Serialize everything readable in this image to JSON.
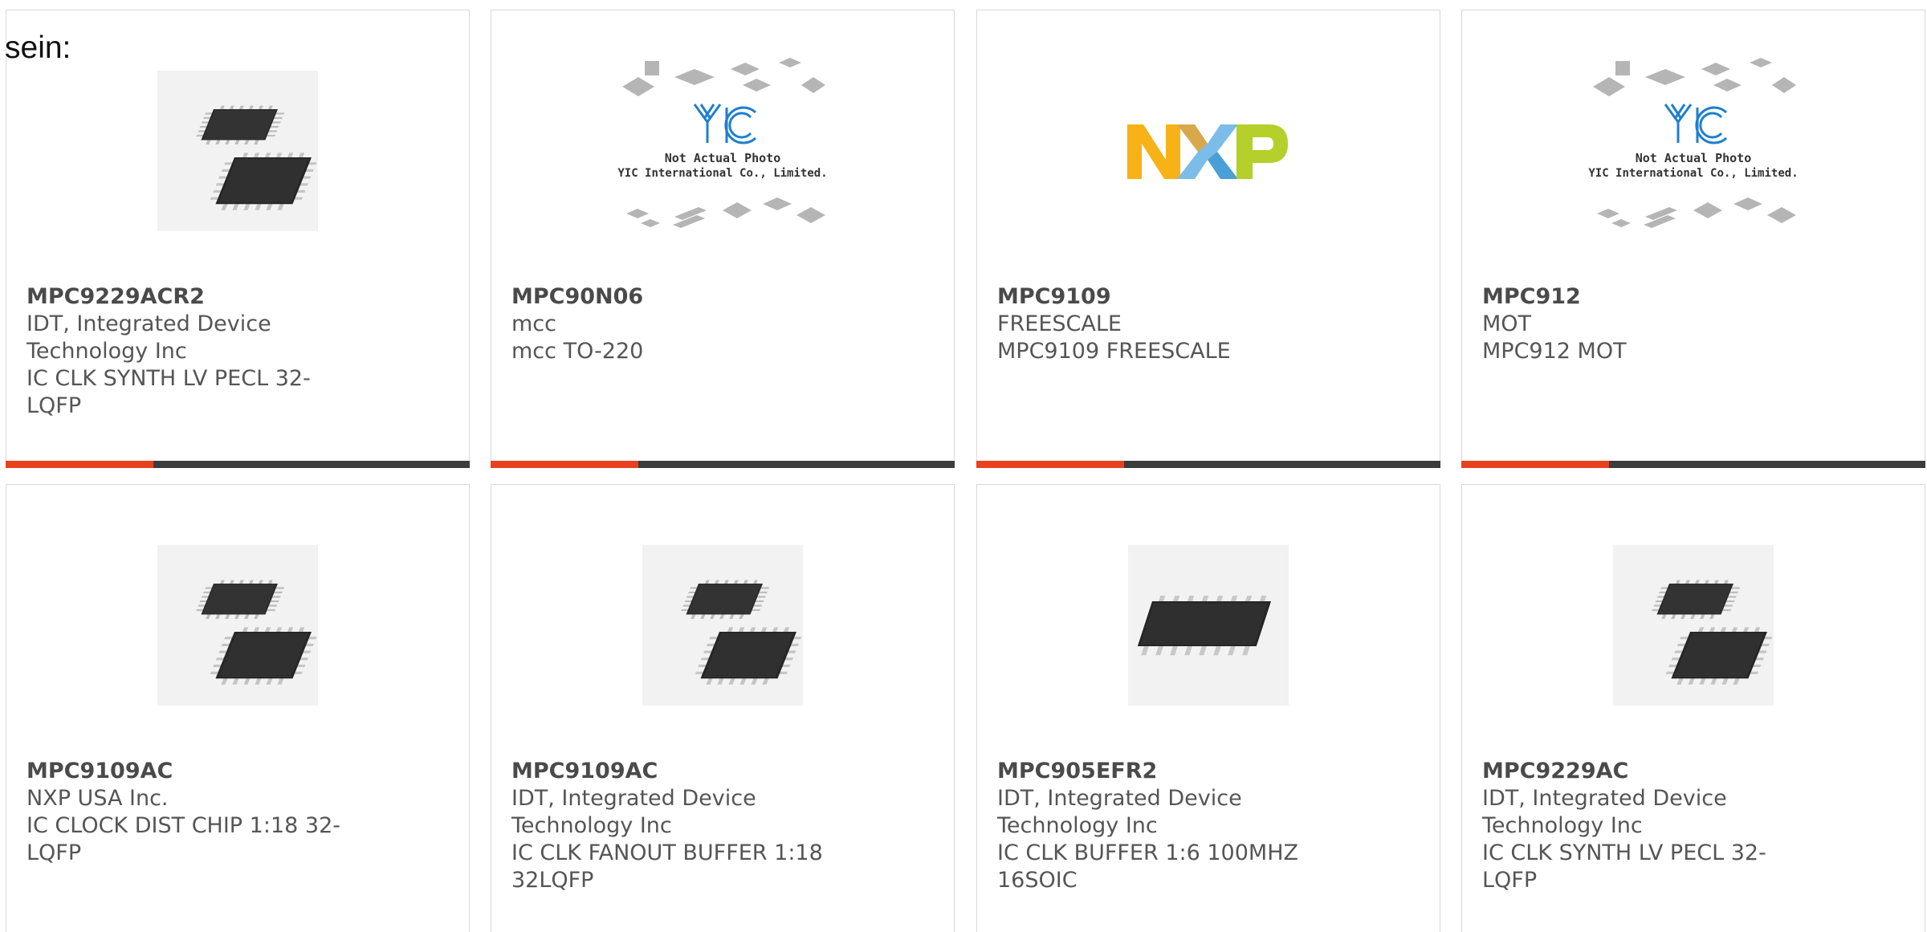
{
  "prefix_text": "sein:",
  "colors": {
    "accent": "#e8411d",
    "bar": "#3c3c3c",
    "border": "#d9d9d9",
    "text": "#555555"
  },
  "products": [
    {
      "part_number": "MPC9229ACR2",
      "manufacturer": "IDT, Integrated Device Technology Inc",
      "description": "IC CLK SYNTH LV PECL 32-LQFP",
      "image": "lqfp-chip-photo"
    },
    {
      "part_number": "MPC90N06",
      "manufacturer": "mcc",
      "description": "mcc TO-220",
      "image": "yic-placeholder",
      "image_caption_1": "Not Actual Photo",
      "image_caption_2": "YIC International Co., Limited."
    },
    {
      "part_number": "MPC9109",
      "manufacturer": "FREESCALE",
      "description": "MPC9109 FREESCALE",
      "image": "nxp-logo",
      "logo_text": "NXP"
    },
    {
      "part_number": "MPC912",
      "manufacturer": "MOT",
      "description": "MPC912 MOT",
      "image": "yic-placeholder",
      "image_caption_1": "Not Actual Photo",
      "image_caption_2": "YIC International Co., Limited."
    },
    {
      "part_number": "MPC9109AC",
      "manufacturer": "NXP USA Inc.",
      "description": "IC CLOCK DIST CHIP 1:18 32-LQFP",
      "image": "lqfp-chip-photo"
    },
    {
      "part_number": "MPC9109AC",
      "manufacturer": "IDT, Integrated Device Technology Inc",
      "description": "IC CLK FANOUT BUFFER 1:18 32LQFP",
      "image": "lqfp-chip-photo"
    },
    {
      "part_number": "MPC905EFR2",
      "manufacturer": "IDT, Integrated Device Technology Inc",
      "description": "IC CLK BUFFER 1:6 100MHZ 16SOIC",
      "image": "soic-chip-photo"
    },
    {
      "part_number": "MPC9229AC",
      "manufacturer": "IDT, Integrated Device Technology Inc",
      "description": "IC CLK SYNTH LV PECL 32-LQFP",
      "image": "lqfp-chip-photo"
    }
  ]
}
